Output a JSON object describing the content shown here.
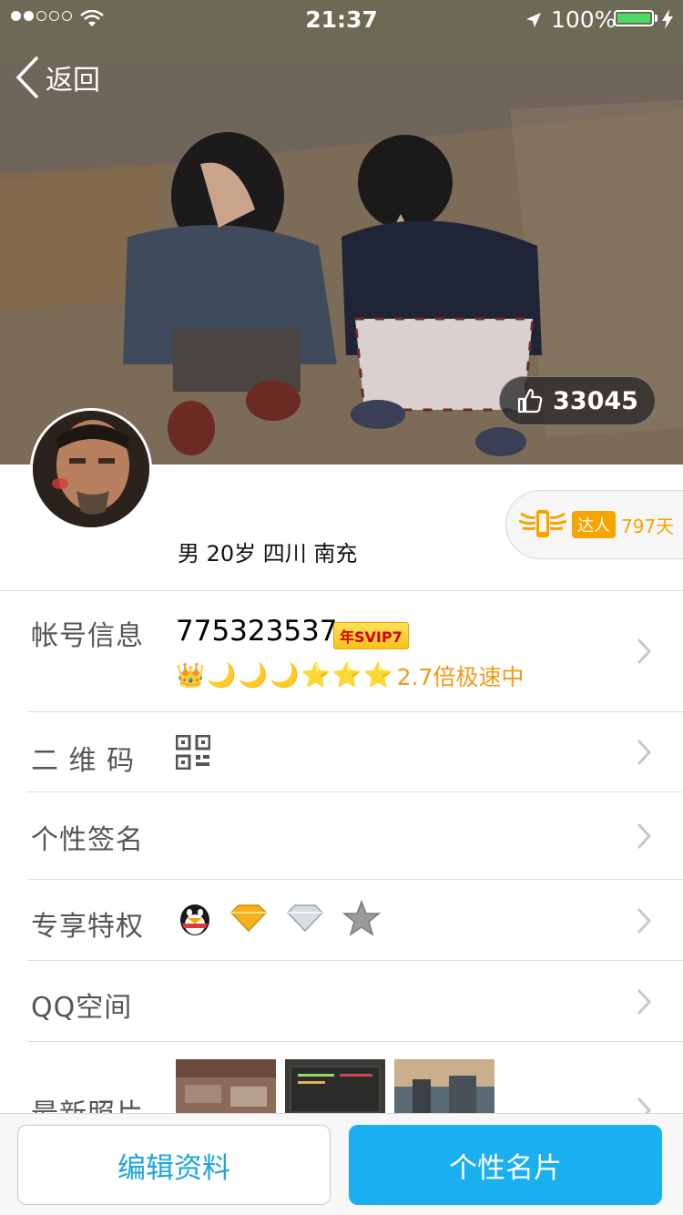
{
  "status_bar": {
    "time": "21:37",
    "battery": "100%",
    "signal_dots": 5,
    "signal_active": 2
  },
  "nav": {
    "back_label": "返回"
  },
  "cover": {
    "likes": "33045"
  },
  "profile": {
    "demographics": "男  20岁  四川 南充",
    "expert_badge": "达人",
    "expert_days": "797天"
  },
  "rows": {
    "account": {
      "label": "帐号信息",
      "qq_number": "775323537",
      "svip_badge": "年SVIP7",
      "speed_text": "2.7倍极速中"
    },
    "qrcode": {
      "label": "二 维 码"
    },
    "signature": {
      "label": "个性签名"
    },
    "privileges": {
      "label": "专享特权"
    },
    "qzone": {
      "label": "QQ空间"
    },
    "photos": {
      "label": "最新照片"
    }
  },
  "bottom": {
    "edit_label": "编辑资料",
    "card_label": "个性名片"
  },
  "colors": {
    "accent": "#1ab0ef",
    "orange": "#f39b18",
    "battery": "#4cd964"
  }
}
